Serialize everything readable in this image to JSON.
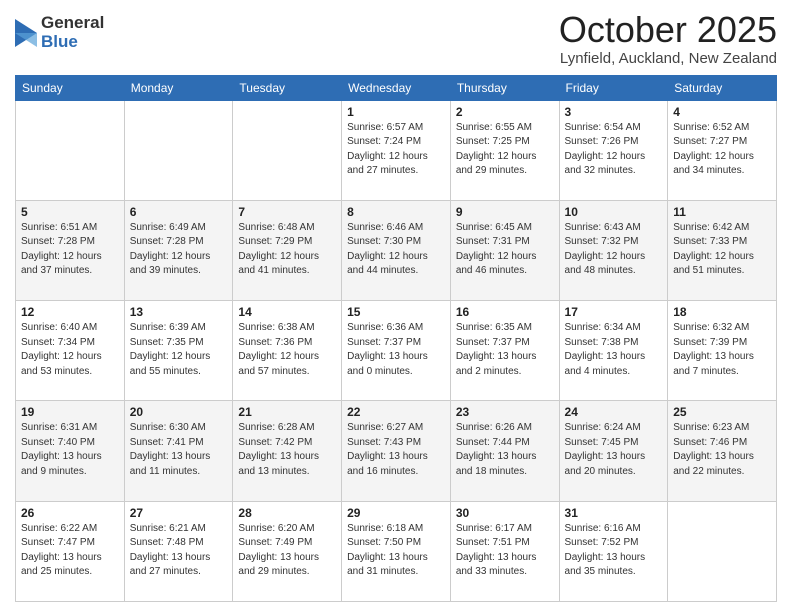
{
  "logo": {
    "general": "General",
    "blue": "Blue"
  },
  "title": "October 2025",
  "location": "Lynfield, Auckland, New Zealand",
  "days": [
    "Sunday",
    "Monday",
    "Tuesday",
    "Wednesday",
    "Thursday",
    "Friday",
    "Saturday"
  ],
  "weeks": [
    [
      {
        "num": "",
        "info": ""
      },
      {
        "num": "",
        "info": ""
      },
      {
        "num": "",
        "info": ""
      },
      {
        "num": "1",
        "info": "Sunrise: 6:57 AM\nSunset: 7:24 PM\nDaylight: 12 hours\nand 27 minutes."
      },
      {
        "num": "2",
        "info": "Sunrise: 6:55 AM\nSunset: 7:25 PM\nDaylight: 12 hours\nand 29 minutes."
      },
      {
        "num": "3",
        "info": "Sunrise: 6:54 AM\nSunset: 7:26 PM\nDaylight: 12 hours\nand 32 minutes."
      },
      {
        "num": "4",
        "info": "Sunrise: 6:52 AM\nSunset: 7:27 PM\nDaylight: 12 hours\nand 34 minutes."
      }
    ],
    [
      {
        "num": "5",
        "info": "Sunrise: 6:51 AM\nSunset: 7:28 PM\nDaylight: 12 hours\nand 37 minutes."
      },
      {
        "num": "6",
        "info": "Sunrise: 6:49 AM\nSunset: 7:28 PM\nDaylight: 12 hours\nand 39 minutes."
      },
      {
        "num": "7",
        "info": "Sunrise: 6:48 AM\nSunset: 7:29 PM\nDaylight: 12 hours\nand 41 minutes."
      },
      {
        "num": "8",
        "info": "Sunrise: 6:46 AM\nSunset: 7:30 PM\nDaylight: 12 hours\nand 44 minutes."
      },
      {
        "num": "9",
        "info": "Sunrise: 6:45 AM\nSunset: 7:31 PM\nDaylight: 12 hours\nand 46 minutes."
      },
      {
        "num": "10",
        "info": "Sunrise: 6:43 AM\nSunset: 7:32 PM\nDaylight: 12 hours\nand 48 minutes."
      },
      {
        "num": "11",
        "info": "Sunrise: 6:42 AM\nSunset: 7:33 PM\nDaylight: 12 hours\nand 51 minutes."
      }
    ],
    [
      {
        "num": "12",
        "info": "Sunrise: 6:40 AM\nSunset: 7:34 PM\nDaylight: 12 hours\nand 53 minutes."
      },
      {
        "num": "13",
        "info": "Sunrise: 6:39 AM\nSunset: 7:35 PM\nDaylight: 12 hours\nand 55 minutes."
      },
      {
        "num": "14",
        "info": "Sunrise: 6:38 AM\nSunset: 7:36 PM\nDaylight: 12 hours\nand 57 minutes."
      },
      {
        "num": "15",
        "info": "Sunrise: 6:36 AM\nSunset: 7:37 PM\nDaylight: 13 hours\nand 0 minutes."
      },
      {
        "num": "16",
        "info": "Sunrise: 6:35 AM\nSunset: 7:37 PM\nDaylight: 13 hours\nand 2 minutes."
      },
      {
        "num": "17",
        "info": "Sunrise: 6:34 AM\nSunset: 7:38 PM\nDaylight: 13 hours\nand 4 minutes."
      },
      {
        "num": "18",
        "info": "Sunrise: 6:32 AM\nSunset: 7:39 PM\nDaylight: 13 hours\nand 7 minutes."
      }
    ],
    [
      {
        "num": "19",
        "info": "Sunrise: 6:31 AM\nSunset: 7:40 PM\nDaylight: 13 hours\nand 9 minutes."
      },
      {
        "num": "20",
        "info": "Sunrise: 6:30 AM\nSunset: 7:41 PM\nDaylight: 13 hours\nand 11 minutes."
      },
      {
        "num": "21",
        "info": "Sunrise: 6:28 AM\nSunset: 7:42 PM\nDaylight: 13 hours\nand 13 minutes."
      },
      {
        "num": "22",
        "info": "Sunrise: 6:27 AM\nSunset: 7:43 PM\nDaylight: 13 hours\nand 16 minutes."
      },
      {
        "num": "23",
        "info": "Sunrise: 6:26 AM\nSunset: 7:44 PM\nDaylight: 13 hours\nand 18 minutes."
      },
      {
        "num": "24",
        "info": "Sunrise: 6:24 AM\nSunset: 7:45 PM\nDaylight: 13 hours\nand 20 minutes."
      },
      {
        "num": "25",
        "info": "Sunrise: 6:23 AM\nSunset: 7:46 PM\nDaylight: 13 hours\nand 22 minutes."
      }
    ],
    [
      {
        "num": "26",
        "info": "Sunrise: 6:22 AM\nSunset: 7:47 PM\nDaylight: 13 hours\nand 25 minutes."
      },
      {
        "num": "27",
        "info": "Sunrise: 6:21 AM\nSunset: 7:48 PM\nDaylight: 13 hours\nand 27 minutes."
      },
      {
        "num": "28",
        "info": "Sunrise: 6:20 AM\nSunset: 7:49 PM\nDaylight: 13 hours\nand 29 minutes."
      },
      {
        "num": "29",
        "info": "Sunrise: 6:18 AM\nSunset: 7:50 PM\nDaylight: 13 hours\nand 31 minutes."
      },
      {
        "num": "30",
        "info": "Sunrise: 6:17 AM\nSunset: 7:51 PM\nDaylight: 13 hours\nand 33 minutes."
      },
      {
        "num": "31",
        "info": "Sunrise: 6:16 AM\nSunset: 7:52 PM\nDaylight: 13 hours\nand 35 minutes."
      },
      {
        "num": "",
        "info": ""
      }
    ]
  ]
}
